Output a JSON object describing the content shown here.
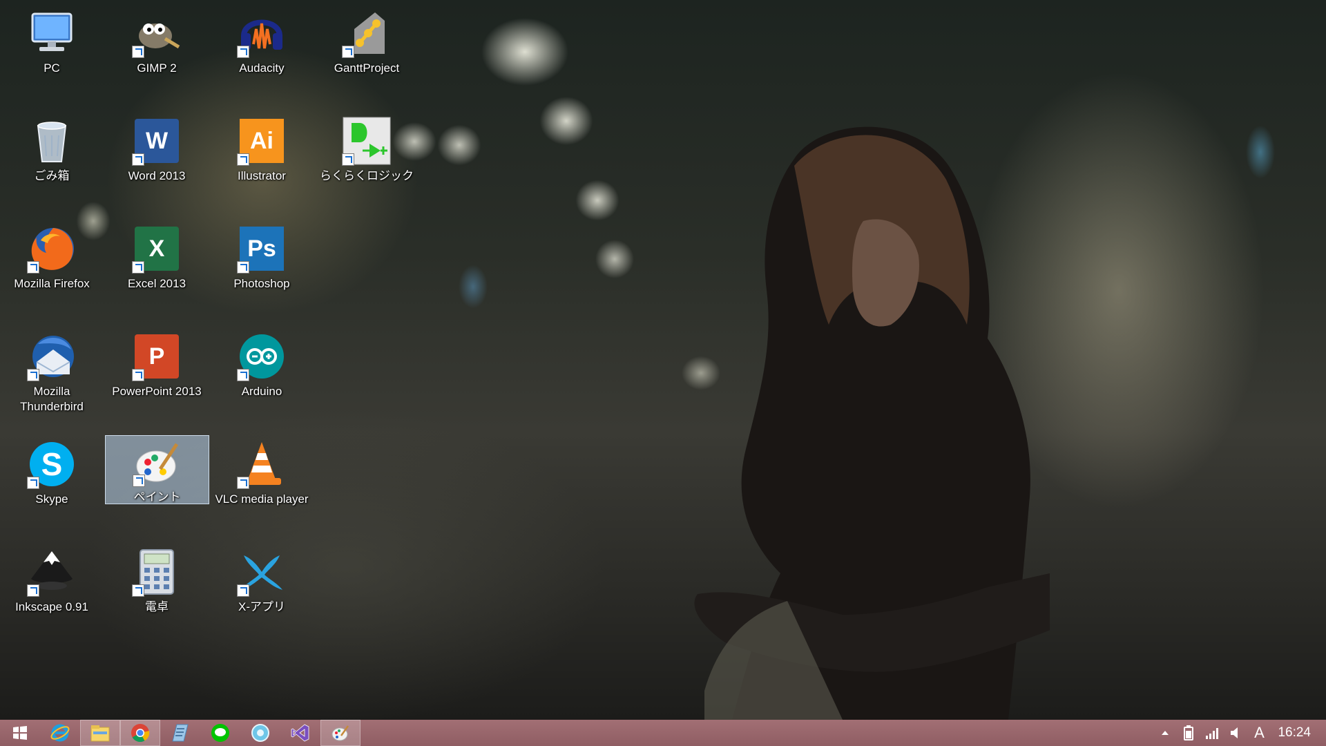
{
  "desktop": {
    "icons": [
      {
        "label": "PC"
      },
      {
        "label": "GIMP 2"
      },
      {
        "label": "Audacity"
      },
      {
        "label": "GanttProject"
      },
      {
        "label": "ごみ箱"
      },
      {
        "label": "Word 2013"
      },
      {
        "label": "Illustrator"
      },
      {
        "label": "らくらくロジック"
      },
      {
        "label": "Mozilla Firefox"
      },
      {
        "label": "Excel 2013"
      },
      {
        "label": "Photoshop"
      },
      {
        "label": "Mozilla Thunderbird"
      },
      {
        "label": "PowerPoint 2013"
      },
      {
        "label": "Arduino"
      },
      {
        "label": "Skype"
      },
      {
        "label": "ペイント"
      },
      {
        "label": "VLC media player"
      },
      {
        "label": "Inkscape 0.91"
      },
      {
        "label": "電卓"
      },
      {
        "label": "X-アプリ"
      }
    ],
    "tile_glyphs": {
      "word": "W",
      "excel": "X",
      "powerpoint": "P",
      "illustrator": "Ai",
      "photoshop": "Ps",
      "skype": "S"
    }
  },
  "taskbar": {
    "items": [
      {
        "icon": "windows-start-icon"
      },
      {
        "icon": "internet-explorer-icon"
      },
      {
        "icon": "file-explorer-icon"
      },
      {
        "icon": "chrome-icon"
      },
      {
        "icon": "notepad-icon"
      },
      {
        "icon": "line-icon"
      },
      {
        "icon": "app-icon"
      },
      {
        "icon": "visual-studio-icon"
      },
      {
        "icon": "paint-icon"
      }
    ],
    "tray": {
      "ime": "A",
      "clock": "16:24"
    }
  },
  "colors": {
    "taskbar": "#9a666c",
    "selection": "#bed7f0",
    "word": "#2b579a",
    "excel": "#217346",
    "powerpoint": "#d24726",
    "illustrator": "#f7941d",
    "photoshop": "#1c73b9",
    "skype": "#00aff0"
  }
}
